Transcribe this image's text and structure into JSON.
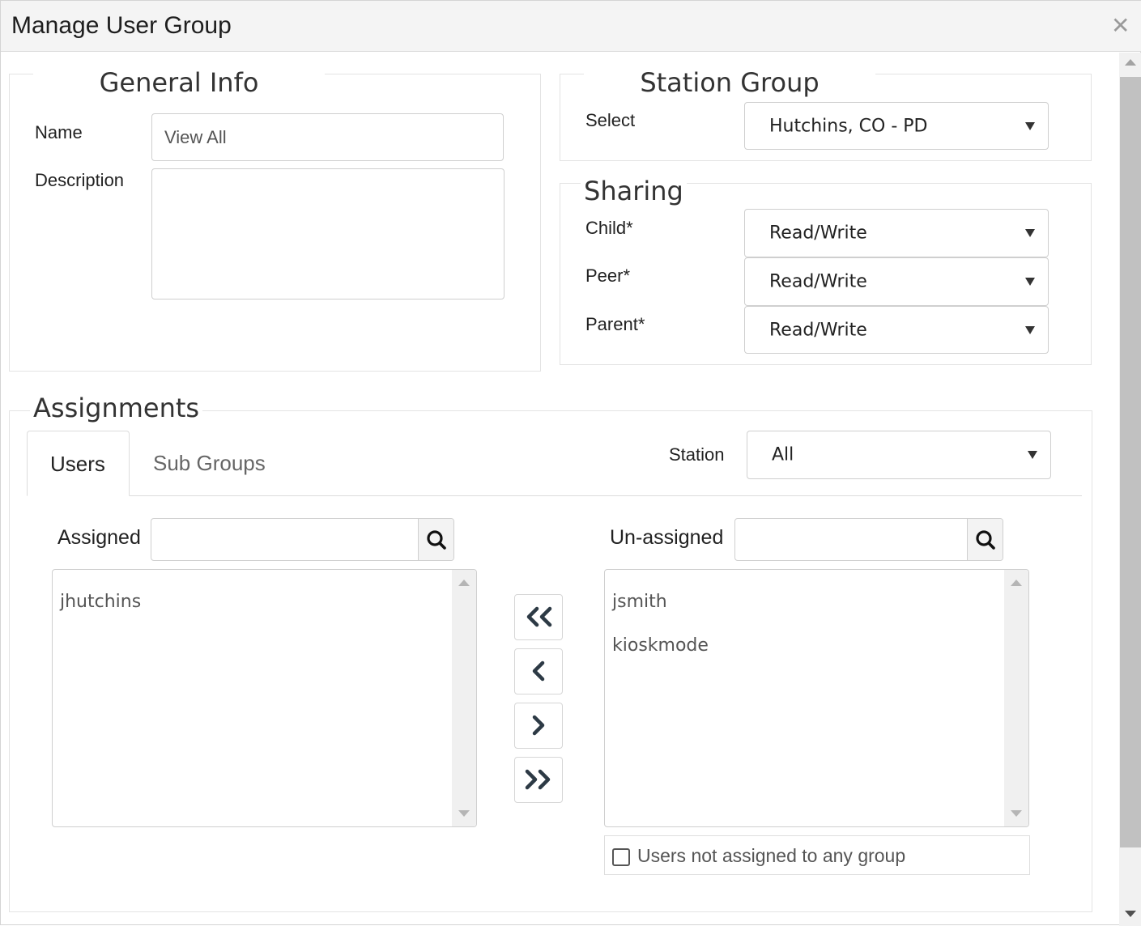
{
  "dialog": {
    "title": "Manage User Group",
    "close_icon": "close-icon"
  },
  "general_info": {
    "legend": "General Info",
    "name_label": "Name",
    "name_value": "View All",
    "description_label": "Description",
    "description_value": ""
  },
  "station_group": {
    "legend": "Station Group",
    "select_label": "Select",
    "select_value": "Hutchins, CO - PD"
  },
  "sharing": {
    "legend": "Sharing",
    "child_label": "Child*",
    "child_value": "Read/Write",
    "peer_label": "Peer*",
    "peer_value": "Read/Write",
    "parent_label": "Parent*",
    "parent_value": "Read/Write"
  },
  "assignments": {
    "legend": "Assignments",
    "tabs": [
      {
        "label": "Users",
        "active": true
      },
      {
        "label": "Sub Groups",
        "active": false
      }
    ],
    "station_label": "Station",
    "station_value": "All",
    "assigned_label": "Assigned",
    "assigned_search": "",
    "unassigned_label": "Un-assigned",
    "unassigned_search": "",
    "assigned_items": [
      "jhutchins"
    ],
    "unassigned_items": [
      "jsmith",
      "kioskmode"
    ],
    "move_buttons": [
      "move-all-left-icon",
      "move-left-icon",
      "move-right-icon",
      "move-all-right-icon"
    ],
    "checkbox_label": "Users not assigned to any group",
    "checkbox_checked": false
  },
  "colors": {
    "titlebar_bg": "#f4f4f4",
    "border": "#cfcfcf",
    "icon_dark": "#2d3a45"
  }
}
